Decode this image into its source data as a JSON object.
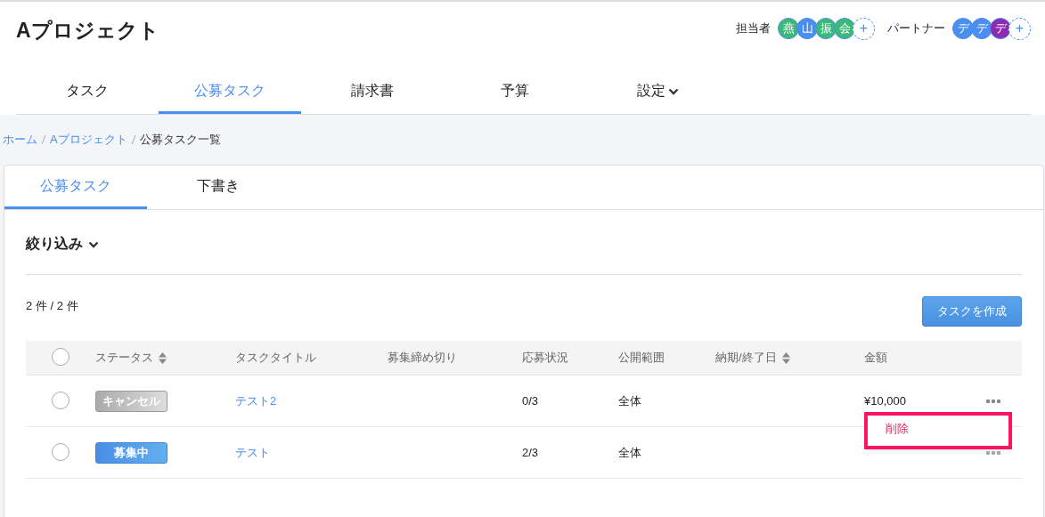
{
  "header": {
    "title": "Aプロジェクト",
    "groups": [
      {
        "label": "担当者",
        "add": "+",
        "members": [
          {
            "initial": "燕",
            "color": "#3cb878"
          },
          {
            "initial": "山",
            "color": "#4a8ef0"
          },
          {
            "initial": "振",
            "color": "#3cb878"
          },
          {
            "initial": "会",
            "color": "#3cb878"
          }
        ]
      },
      {
        "label": "パートナー",
        "add": "+",
        "members": [
          {
            "initial": "デ",
            "color": "#4a8ef0"
          },
          {
            "initial": "デ",
            "color": "#4a8ef0"
          },
          {
            "initial": "デ",
            "color": "#8e2bb0"
          }
        ]
      }
    ]
  },
  "nav": [
    {
      "label": "タスク",
      "selected": false,
      "kind": "link"
    },
    {
      "label": "公募タスク",
      "selected": true,
      "kind": "link"
    },
    {
      "label": "請求書",
      "selected": false,
      "kind": "link"
    },
    {
      "label": "予算",
      "selected": false,
      "kind": "link"
    },
    {
      "label": "設定",
      "selected": false,
      "kind": "menu"
    }
  ],
  "breadcrumb": [
    {
      "label": "ホーム",
      "kind": "link"
    },
    {
      "label": "Aプロジェクト",
      "kind": "link"
    },
    {
      "label": "公募タスク一覧",
      "kind": "current"
    }
  ],
  "tabs": [
    {
      "label": "公募タスク",
      "selected": true
    },
    {
      "label": "下書き",
      "selected": false
    }
  ],
  "filter": {
    "label": "絞り込み"
  },
  "count": "2 件 / 2 件",
  "create_button": "タスクを作成",
  "table": {
    "select_all": false,
    "columns": [
      {
        "label": "ステータス",
        "sortable": true
      },
      {
        "label": "タスクタイトル",
        "sortable": false
      },
      {
        "label": "募集締め切り",
        "sortable": false
      },
      {
        "label": "応募状況",
        "sortable": false
      },
      {
        "label": "公開範囲",
        "sortable": false
      },
      {
        "label": "納期/終了日",
        "sortable": true
      },
      {
        "label": "金額",
        "sortable": false
      }
    ],
    "rows": [
      {
        "selected": false,
        "status": {
          "label": "キャンセル",
          "kind": "cancelled"
        },
        "title": "テスト2",
        "applications": "0/3",
        "scope": "全体",
        "amount": "¥10,000",
        "menu_open": true,
        "menu_items": [
          {
            "label": "削除",
            "highlighted": true
          }
        ]
      },
      {
        "selected": false,
        "status": {
          "label": "募集中",
          "kind": "recruiting"
        },
        "title": "テスト",
        "applications": "2/3",
        "scope": "全体",
        "menu_open": false,
        "menu_items": []
      }
    ]
  }
}
